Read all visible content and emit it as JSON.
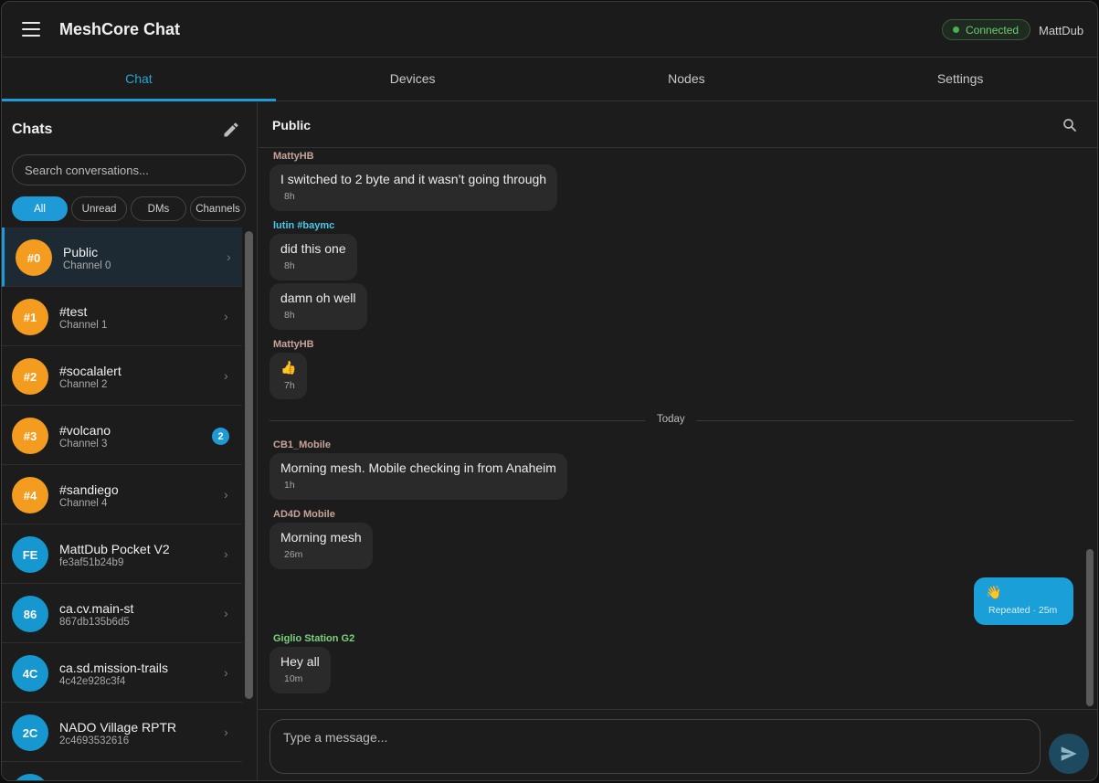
{
  "app": {
    "title": "MeshCore Chat"
  },
  "status": {
    "label": "Connected",
    "color": "#4caf50"
  },
  "user": {
    "name": "MattDub"
  },
  "tabs": [
    {
      "label": "Chat",
      "active": true
    },
    {
      "label": "Devices"
    },
    {
      "label": "Nodes"
    },
    {
      "label": "Settings"
    }
  ],
  "sidebar": {
    "title": "Chats",
    "search_placeholder": "Search conversations...",
    "filters": [
      "All",
      "Unread",
      "DMs",
      "Channels"
    ],
    "conversations": [
      {
        "avatar": "#0",
        "name": "Public",
        "sub": "Channel 0",
        "color": "orange",
        "selected": true
      },
      {
        "avatar": "#1",
        "name": "#test",
        "sub": "Channel 1",
        "color": "orange"
      },
      {
        "avatar": "#2",
        "name": "#socalalert",
        "sub": "Channel 2",
        "color": "orange"
      },
      {
        "avatar": "#3",
        "name": "#volcano",
        "sub": "Channel 3",
        "color": "orange",
        "badge": "2"
      },
      {
        "avatar": "#4",
        "name": "#sandiego",
        "sub": "Channel 4",
        "color": "orange"
      },
      {
        "avatar": "FE",
        "name": "MattDub Pocket V2",
        "sub": "fe3af51b24b9",
        "color": "blue"
      },
      {
        "avatar": "86",
        "name": "ca.cv.main-st",
        "sub": "867db135b6d5",
        "color": "blue"
      },
      {
        "avatar": "4C",
        "name": "ca.sd.mission-trails",
        "sub": "4c42e928c3f4",
        "color": "blue"
      },
      {
        "avatar": "2C",
        "name": "NADO Village RPTR",
        "sub": "2c4693532616",
        "color": "blue"
      },
      {
        "avatar": "",
        "name": "",
        "sub": "",
        "color": "blue"
      }
    ]
  },
  "chat": {
    "title": "Public",
    "messages": [
      {
        "sender": "MattyHB",
        "text": "I switched to 2 byte and it wasn’t going through",
        "time": "8h"
      },
      {
        "sender": "lutin #baymc",
        "text": "did this one",
        "time": "8h"
      },
      {
        "text": "damn oh well",
        "time": "8h"
      },
      {
        "sender": "MattyHB",
        "text": "👍",
        "time": "7h"
      },
      {
        "sender": "CB1_Mobile",
        "text": "Morning mesh.  Mobile checking in from Anaheim",
        "time": "1h"
      },
      {
        "sender": "AD4D Mobile",
        "text": "Morning mesh",
        "time": "26m"
      },
      {
        "text": "👋",
        "time": "Repeated · 25m",
        "mine": true
      },
      {
        "sender": "Giglio Station G2",
        "text": "Hey all",
        "time": "10m"
      }
    ],
    "divider_label": "Today",
    "composer_placeholder": "Type a message..."
  },
  "colors": {
    "accent": "#1e9ad6",
    "sender_default": "#c7a39a",
    "sender_cyan": "#4cc8e8",
    "sender_green": "#7bd37f"
  }
}
